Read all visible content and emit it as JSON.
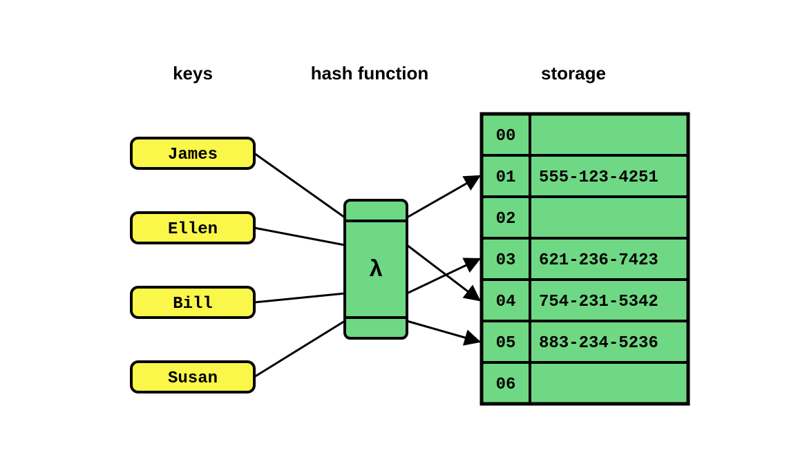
{
  "headers": {
    "keys": "keys",
    "hash": "hash function",
    "storage": "storage"
  },
  "keys": [
    "James",
    "Ellen",
    "Bill",
    "Susan"
  ],
  "func": {
    "label": "λ"
  },
  "storage": [
    {
      "idx": "00",
      "val": ""
    },
    {
      "idx": "01",
      "val": "555-123-4251"
    },
    {
      "idx": "02",
      "val": ""
    },
    {
      "idx": "03",
      "val": "621-236-7423"
    },
    {
      "idx": "04",
      "val": "754-231-5342"
    },
    {
      "idx": "05",
      "val": "883-234-5236"
    },
    {
      "idx": "06",
      "val": ""
    }
  ],
  "colors": {
    "yellow": "#faf74a",
    "green": "#6fd884",
    "stroke": "#000000"
  },
  "chart_data": {
    "type": "table",
    "title": "Hash table diagram",
    "keys": [
      "James",
      "Ellen",
      "Bill",
      "Susan"
    ],
    "storage": {
      "00": "",
      "01": "555-123-4251",
      "02": "",
      "03": "621-236-7423",
      "04": "754-231-5342",
      "05": "883-234-5236",
      "06": ""
    }
  }
}
